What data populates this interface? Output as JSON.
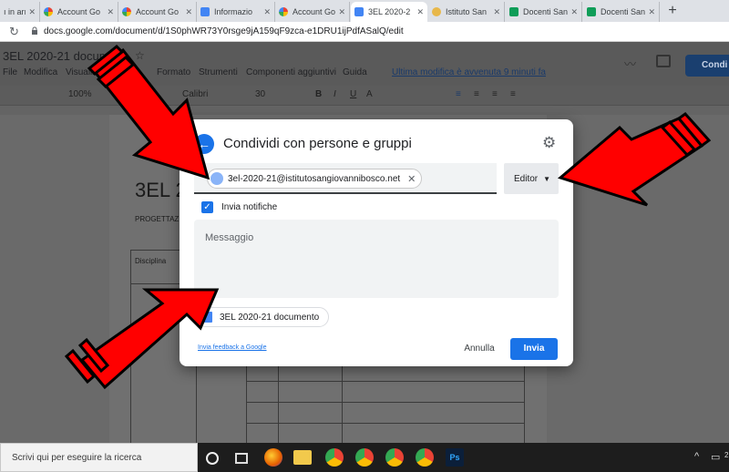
{
  "browser": {
    "tabs": [
      {
        "label": "ı in arı",
        "favicon": "doc-icon"
      },
      {
        "label": "Account Go",
        "favicon": "google-g-icon"
      },
      {
        "label": "Account Go",
        "favicon": "google-g-icon"
      },
      {
        "label": "Informazio",
        "favicon": "blue-doc-icon"
      },
      {
        "label": "Account Go",
        "favicon": "google-g-icon"
      },
      {
        "label": "3EL 2020-2",
        "favicon": "docs-icon",
        "active": true
      },
      {
        "label": "Istituto San",
        "favicon": "school-icon"
      },
      {
        "label": "Docenti San",
        "favicon": "sheets-icon"
      },
      {
        "label": "Docenti San",
        "favicon": "sheets-icon"
      }
    ],
    "new_tab_symbol": "+",
    "url": "docs.google.com/document/d/1S0phWR73Y0rsge9jA159qF9zca-e1DRU1ijPdfASalQ/edit"
  },
  "doc": {
    "title": "3EL 2020-21 document",
    "menu": [
      "File",
      "Modifica",
      "Visualiz",
      "",
      "Formato",
      "Strumenti",
      "Componenti aggiuntivi",
      "Guida"
    ],
    "last_edit": "Ultima modifica è avvenuta 9 minuti fa",
    "share_label": "Condi",
    "toolbar": {
      "zoom": "100%",
      "font": "Calibri",
      "size": "30",
      "bold": "B",
      "italic": "I",
      "underline": "U",
      "color": "A"
    },
    "heading": "3EL 2",
    "subheading": "PROGETTAZ",
    "table_first_cell": "Disciplina"
  },
  "dialog": {
    "title": "Condividi con persone e gruppi",
    "recipient_email": "3el-2020-21@istitutosangiovannibosco.net",
    "role_label": "Editor",
    "notify_label": "Invia notifiche",
    "notify_checked": true,
    "message_placeholder": "Messaggio",
    "attached_doc": "3EL 2020-21 documento",
    "feedback_link": "Invia feedback a Google",
    "cancel_label": "Annulla",
    "send_label": "Invia",
    "accent_color": "#1a73e8"
  },
  "taskbar": {
    "search_placeholder": "Scrivi qui per eseguire la ricerca",
    "icons": [
      "task-view-icon",
      "firefox-icon",
      "file-explorer-icon",
      "chrome-icon",
      "chrome-icon",
      "chrome-icon",
      "chrome-icon",
      "photoshop-icon"
    ],
    "photoshop_label": "Ps",
    "clock": "2"
  },
  "annotation": {
    "arrow_color": "#ff0000",
    "arrow_count": 3
  }
}
